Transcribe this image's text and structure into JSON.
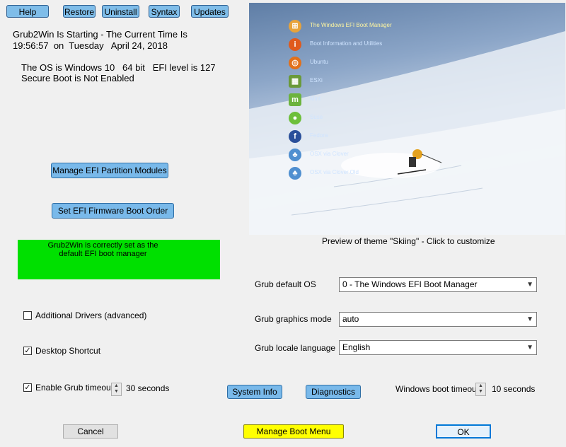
{
  "toolbar": {
    "help": "Help",
    "restore": "Restore",
    "uninstall": "Uninstall",
    "syntax": "Syntax",
    "updates": "Updates"
  },
  "status": {
    "start_line1": "Grub2Win Is Starting - The Current Time Is",
    "start_line2": "19:56:57  on  Tuesday   April 24, 2018",
    "os_line": "The OS is Windows 10   64 bit   EFI level is 127",
    "secure_boot": "Secure Boot is Not Enabled"
  },
  "buttons": {
    "manage_efi": "Manage EFI Partition Modules",
    "set_efi_order": "Set EFI Firmware Boot Order",
    "system_info": "System Info",
    "diagnostics": "Diagnostics",
    "cancel": "Cancel",
    "manage_boot_menu": "Manage Boot Menu",
    "ok": "OK"
  },
  "efi_status": {
    "line1": "Grub2Win is correctly set as the",
    "line2": "default EFI boot manager",
    "color": "#00e000"
  },
  "options": {
    "additional_drivers": {
      "label": "Additional Drivers (advanced)",
      "checked": false
    },
    "desktop_shortcut": {
      "label": "Desktop Shortcut",
      "checked": true
    },
    "grub_timeout": {
      "label": "Enable Grub timeout",
      "checked": true,
      "value": "30 seconds"
    }
  },
  "preview": {
    "caption": "Preview of theme  \"Skiing\"  - Click to customize",
    "menu": [
      {
        "label": "The Windows EFI Boot Manager",
        "icon": "windows-icon",
        "color": "#e8a33a"
      },
      {
        "label": "Boot Information and Utilities",
        "icon": "info-icon",
        "color": "#e05a1c"
      },
      {
        "label": "Ubuntu",
        "icon": "ubuntu-icon",
        "color": "#e2701a"
      },
      {
        "label": "ESXi",
        "icon": "esxi-icon",
        "color": "#6a9a3a"
      },
      {
        "label": "Mint",
        "icon": "mint-icon",
        "color": "#6cb33e"
      },
      {
        "label": "Suse",
        "icon": "suse-icon",
        "color": "#6dbf3a"
      },
      {
        "label": "Fedora",
        "icon": "fedora-icon",
        "color": "#2a4f9a"
      },
      {
        "label": "OSX via Clover",
        "icon": "clover-icon",
        "color": "#4f8fd0"
      },
      {
        "label": "OSX via Clover.Old",
        "icon": "clover-old-icon",
        "color": "#4f8fd0"
      }
    ]
  },
  "settings": {
    "default_os": {
      "label": "Grub default OS",
      "value": "0  -  The Windows EFI Boot Manager"
    },
    "graphics_mode": {
      "label": "Grub graphics mode",
      "value": "auto"
    },
    "locale": {
      "label": "Grub locale language",
      "value": "English"
    },
    "windows_timeout": {
      "label": "Windows boot timeout",
      "value": "10 seconds"
    }
  }
}
